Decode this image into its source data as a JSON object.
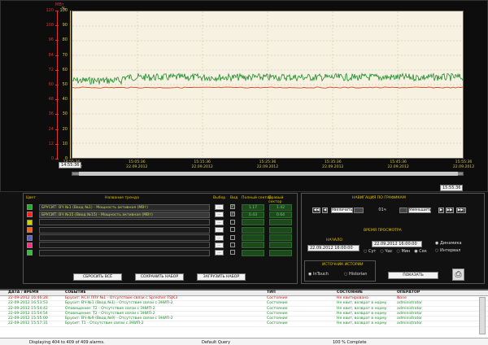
{
  "chart": {
    "left_axis_unit": "МВт",
    "right_axis_unit": "%",
    "left_ticks": [
      "120",
      "108",
      "96",
      "84",
      "72",
      "60",
      "48",
      "36",
      "24",
      "12",
      "0"
    ],
    "right_ticks": [
      "100",
      "90",
      "80",
      "70",
      "60",
      "50",
      "40",
      "30",
      "20",
      "10",
      "0"
    ],
    "x_labels": [
      {
        "time": "14:55:36",
        "date": "22.09.2012"
      },
      {
        "time": "15:05:36",
        "date": "22.09.2012"
      },
      {
        "time": "15:15:36",
        "date": "22.09.2012"
      },
      {
        "time": "15:25:36",
        "date": "22.09.2012"
      },
      {
        "time": "15:35:36",
        "date": "22.09.2012"
      },
      {
        "time": "15:45:36",
        "date": "22.09.2012"
      },
      {
        "time": "15:55:36",
        "date": "22.09.2012"
      }
    ],
    "range_start": "14:55:36",
    "range_end": "15:55:36",
    "series_green_level_pct": 55,
    "series_red_level_pct": 48,
    "colors": {
      "green": "#1a8c2a",
      "red": "#e04020",
      "plot_bg": "#f6f1e0"
    }
  },
  "trends": {
    "headers": {
      "color": "Цвет",
      "name": "Название тренда",
      "choose": "Выбор",
      "view": "Вид",
      "full": "Полный сектор",
      "right": "Правый сектор"
    },
    "rows": [
      {
        "color": "#20b020",
        "name": "БРУСИТ: ВЧ №1 (Ввод №1) - Мощность активная (МВт)",
        "full": "1.17",
        "rightv": "1.42",
        "checked": true
      },
      {
        "color": "#ff2020",
        "name": "БРУСИТ: ВЧ №15 (Ввод №15) - Мощность активная (МВт)",
        "full": "0.43",
        "rightv": "0.64",
        "checked": true
      },
      {
        "color": "#d0d000",
        "name": "",
        "full": "",
        "rightv": "",
        "checked": false
      },
      {
        "color": "#ff6020",
        "name": "",
        "full": "",
        "rightv": "",
        "checked": false
      },
      {
        "color": "#6060c0",
        "name": "",
        "full": "",
        "rightv": "",
        "checked": false
      },
      {
        "color": "#ff3080",
        "name": "",
        "full": "",
        "rightv": "",
        "checked": false
      },
      {
        "color": "#30c030",
        "name": "",
        "full": "",
        "rightv": "",
        "checked": false
      }
    ],
    "btn_reset": "СБРОСИТЬ ВСЁ",
    "btn_save": "СОХРАНИТЬ НАБОР",
    "btn_load": "ЗАГРУЗИТЬ НАБОР"
  },
  "nav": {
    "title": "НАВИГАЦИЯ ПО ГРАФИКАМ",
    "zoom_in": "Увеличить",
    "zoom_out": "Уменьшить",
    "scale": "01ч",
    "view_time_title": "ВРЕМЯ ПРОСМОТРА",
    "start_label": "НАЧАЛО",
    "start_value": "22.09.2012 16:00:00",
    "end_value": "22.09.2012 16:00:00",
    "mode_dynamic": "Динамика",
    "mode_interval": "Интервал",
    "radios": [
      "Сут",
      "Час",
      "Мин",
      "Сек"
    ],
    "history_title": "ИСТОЧНИК ИСТОРИИ",
    "hist_intouch": "InTouch",
    "hist_historian": "Historian",
    "show": "ПОКАЗАТЬ"
  },
  "alarms": {
    "headers": [
      "ДАТА / ВРЕМЯ",
      "СОБЫТИЕ",
      "ТИП",
      "СОСТОЯНИЕ",
      "ОПЕРАТОР"
    ],
    "rows": [
      {
        "dt": "22-09-2012 16:46:28",
        "ev": "Брусит: КСН ЛПУ №1 - Отсутствие связи с Sprecher TSJK3",
        "type": "Состояние",
        "state": "Не квитировано",
        "op": "None",
        "color": "#d01010"
      },
      {
        "dt": "22-09-2012 16:53:53",
        "ev": "Брусит: ВЧ-№1 (Ввод №1) - Отсутствие связи с ЭНИП-2",
        "type": "Состояние",
        "state": "Не квит, возврат в норму",
        "op": "administrator",
        "color": "#1a8c2a"
      },
      {
        "dt": "22-09-2012 15:54:42",
        "ev": "Оповещение: Т2 - Отсутствие связи с ЭНИП-2",
        "type": "Состояние",
        "state": "Не квит, возврат в норму",
        "op": "administrator",
        "color": "#1a8c2a"
      },
      {
        "dt": "22-09-2012 15:54:54",
        "ev": "Оповещение: Т2 - Отсутствие связи с ЭНИП-2",
        "type": "Состояние",
        "state": "Не квит, возврат в норму",
        "op": "administrator",
        "color": "#1a8c2a"
      },
      {
        "dt": "22-09-2012 15:55:00",
        "ev": "Брусит: ВЧ-№9 (Ввод №9) - Отсутствие связи с ЭНИП-2",
        "type": "Состояние",
        "state": "Не квит, возврат в норму",
        "op": "administrator",
        "color": "#1a8c2a"
      },
      {
        "dt": "22-09-2012 15:57:31",
        "ev": "Брусит: Т1 - Отсутствие связи с ЭНИП-2",
        "type": "Состояние",
        "state": "Не квит, возврат в норму",
        "op": "administrator",
        "color": "#1a8c2a"
      }
    ],
    "status_count": "Displaying 404 to 409 of 409 alarms.",
    "status_query": "Default Query",
    "status_complete": "100 % Complete"
  }
}
